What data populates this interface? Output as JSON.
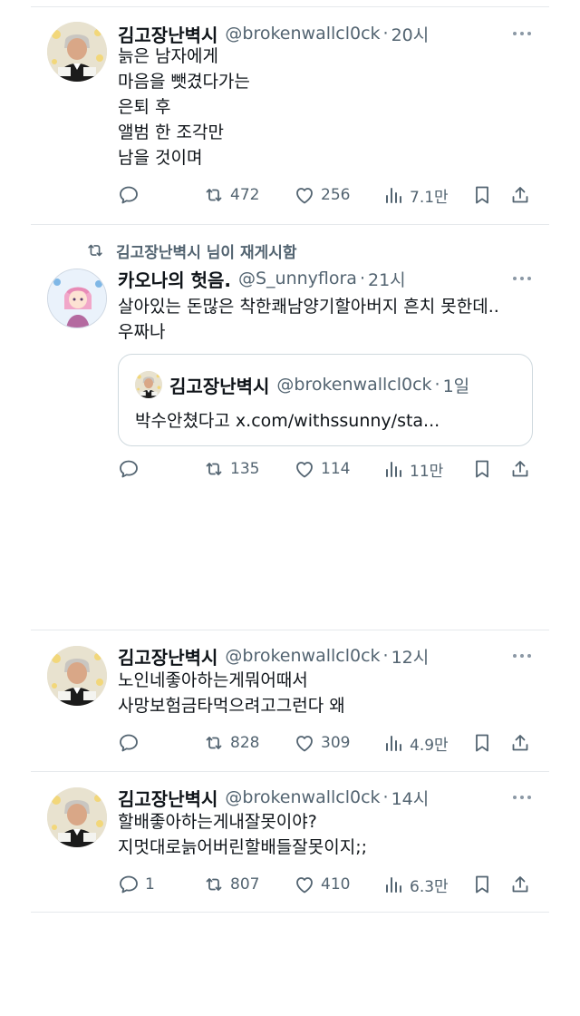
{
  "colors": {
    "text": "#0f1419",
    "secondary": "#536471",
    "divider": "#e6e9ec"
  },
  "tweets": [
    {
      "author": "김고장난벽시",
      "handle": "@brokenwallcl0ck",
      "time": "20시",
      "lines": [
        "늙은 남자에게",
        "마음을 뺏겼다가는",
        "은퇴 후",
        "앨범 한 조각만",
        "남을 것이며"
      ],
      "reply_count": "",
      "retweet_count": "472",
      "like_count": "256",
      "view_count": "7.1만"
    },
    {
      "retweeted_by": "김고장난벽시 님이 재게시함",
      "author": "카오나의 헛음.",
      "handle": "@S_unnyflora",
      "time": "21시",
      "lines": [
        "살아있는 돈많은 착한쾌남양기할아버지 흔치 못한데..",
        "우짜나"
      ],
      "quote": {
        "author": "김고장난벽시",
        "handle": "@brokenwallcl0ck",
        "time": "1일",
        "text": "박수안쳤다고 x.com/withssunny/sta..."
      },
      "reply_count": "",
      "retweet_count": "135",
      "like_count": "114",
      "view_count": "11만"
    },
    {
      "author": "김고장난벽시",
      "handle": "@brokenwallcl0ck",
      "time": "12시",
      "lines": [
        "노인네좋아하는게뭐어때서",
        "사망보험금타먹으려고그런다 왜"
      ],
      "reply_count": "",
      "retweet_count": "828",
      "like_count": "309",
      "view_count": "4.9만"
    },
    {
      "author": "김고장난벽시",
      "handle": "@brokenwallcl0ck",
      "time": "14시",
      "lines": [
        "할배좋아하는게내잘못이야?",
        "지멋대로늙어버린할배들잘못이지;;"
      ],
      "reply_count": "1",
      "retweet_count": "807",
      "like_count": "410",
      "view_count": "6.3만"
    }
  ]
}
